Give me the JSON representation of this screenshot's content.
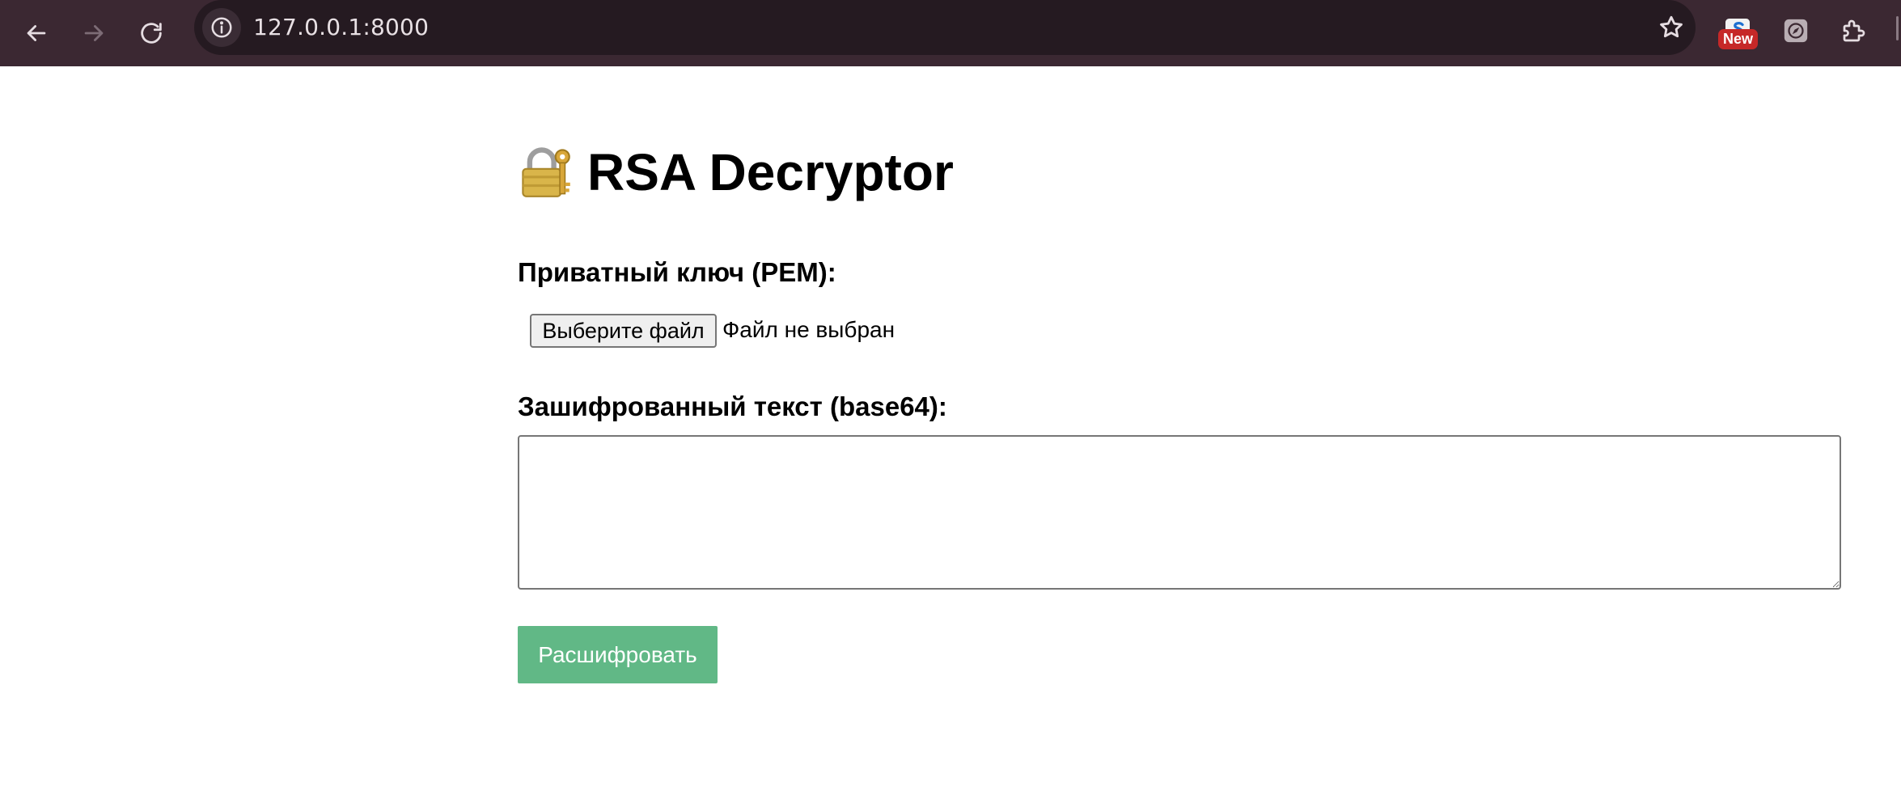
{
  "browser": {
    "url": "127.0.0.1:8000",
    "extension_badge": "New"
  },
  "page": {
    "title": "RSA Decryptor",
    "title_icon": "lock-with-key-icon",
    "private_key_label": "Приватный ключ (PEM):",
    "file_button_label": "Выберите файл",
    "file_status": "Файл не выбран",
    "ciphertext_label": "Зашифрованный текст (base64):",
    "ciphertext_value": "",
    "decrypt_button_label": "Расшифровать"
  },
  "colors": {
    "chrome_bg": "#3b2832",
    "omnibox_bg": "#251a21",
    "decrypt_button_bg": "#61b886",
    "badge_bg": "#c62828"
  }
}
